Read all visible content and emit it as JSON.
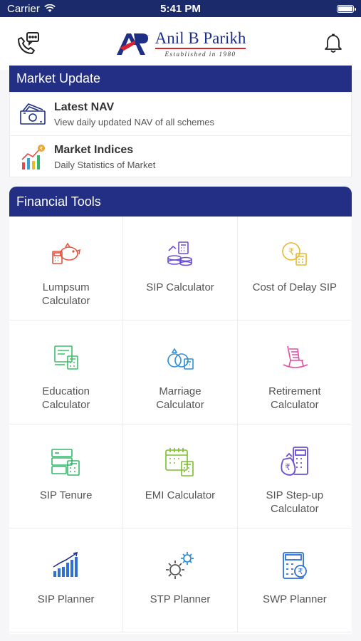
{
  "status_bar": {
    "carrier": "Carrier",
    "time": "5:41 PM"
  },
  "header": {
    "logo_name": "Anil B Parikh",
    "logo_tagline": "Established in 1980",
    "left_icon": "phone-chat-icon",
    "right_icon": "bell-icon"
  },
  "market_update": {
    "title": "Market Update",
    "items": [
      {
        "title": "Latest NAV",
        "subtitle": "View daily updated NAV of all schemes",
        "icon": "money-icon"
      },
      {
        "title": "Market Indices",
        "subtitle": "Daily Statistics of Market",
        "icon": "chart-icon"
      }
    ]
  },
  "financial_tools": {
    "title": "Financial Tools",
    "items": [
      {
        "label": "Lumpsum Calculator",
        "icon": "piggy-bank-calculator-icon",
        "color": "#e4533f"
      },
      {
        "label": "SIP Calculator",
        "icon": "coins-calculator-icon",
        "color": "#6a4fd6"
      },
      {
        "label": "Cost of Delay SIP",
        "icon": "rupee-coin-calculator-icon",
        "color": "#e7b92e"
      },
      {
        "label": "Education Calculator",
        "icon": "book-calculator-icon",
        "color": "#3fbf6a"
      },
      {
        "label": "Marriage Calculator",
        "icon": "rings-calculator-icon",
        "color": "#2f8fd6"
      },
      {
        "label": "Retirement Calculator",
        "icon": "rocking-chair-icon",
        "color": "#e04fa3"
      },
      {
        "label": "SIP Tenure",
        "icon": "card-calculator-icon",
        "color": "#33b96a"
      },
      {
        "label": "EMI Calculator",
        "icon": "calendar-calculator-icon",
        "color": "#7abf2d"
      },
      {
        "label": "SIP Step-up Calculator",
        "icon": "rupee-bag-calculator-icon",
        "color": "#6a4fd6"
      },
      {
        "label": "SIP Planner",
        "icon": "growth-bars-icon",
        "color": "#2f6fd6"
      },
      {
        "label": "STP Planner",
        "icon": "gears-icon",
        "color": "#2f8fd6"
      },
      {
        "label": "SWP Planner",
        "icon": "rupee-calculator-icon",
        "color": "#2f6fd6"
      }
    ]
  }
}
